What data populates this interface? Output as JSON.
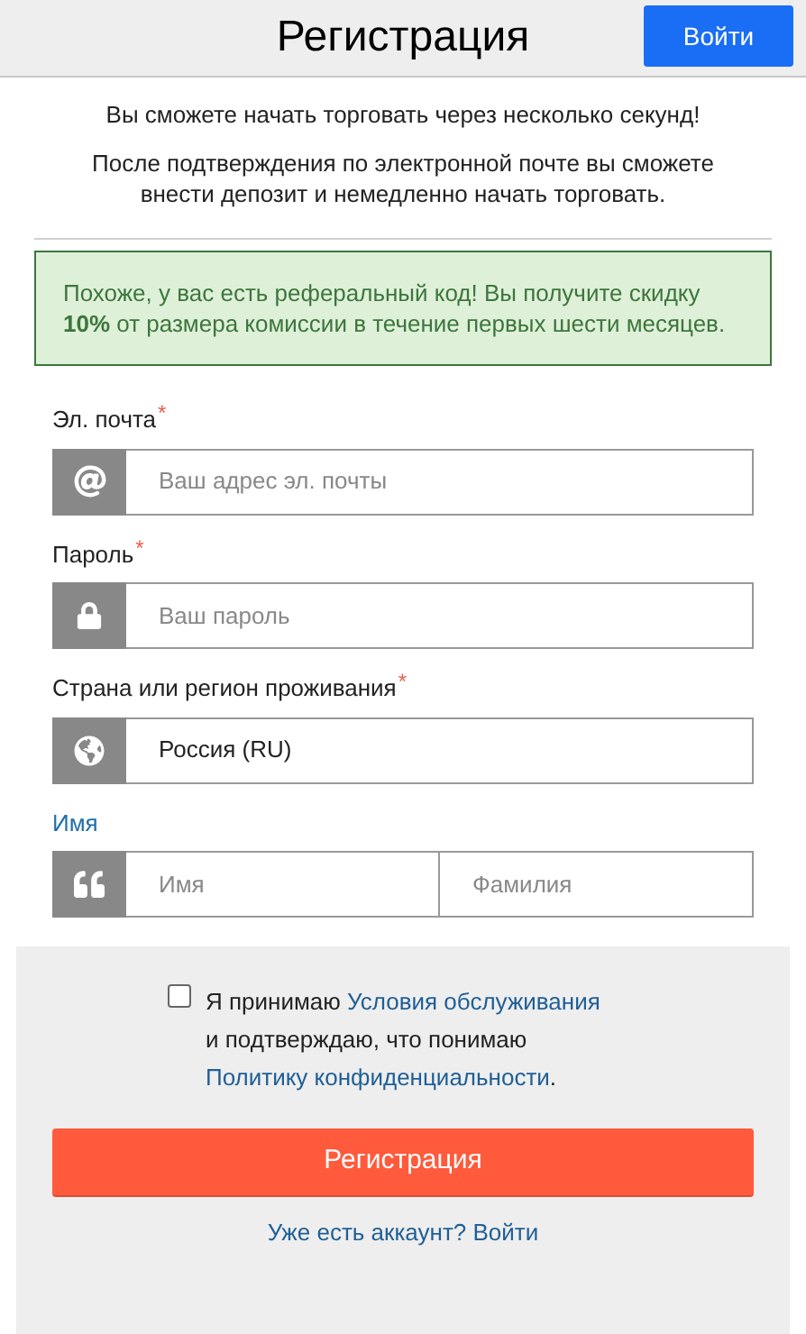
{
  "header": {
    "title": "Регистрация",
    "login_button": "Войти"
  },
  "intro": [
    "Вы сможете начать торговать через несколько секунд!",
    "После подтверждения по электронной почте вы сможете внести депозит и немедленно начать торговать."
  ],
  "referral_notice": "Похоже, у вас есть реферальный код! Вы получите скидку **10%** от размера комиссии в течение первых шести месяцев.",
  "fields": [
    {
      "label": "Эл. почта",
      "required_mark": "*",
      "kind": "email",
      "inputs": [
        {
          "placeholder": "Ваш адрес эл. почты"
        }
      ]
    },
    {
      "label": "Пароль",
      "required_mark": "*",
      "kind": "password",
      "inputs": [
        {
          "placeholder": "Ваш пароль"
        }
      ]
    },
    {
      "label": "Страна или регион проживания",
      "required_mark": "*",
      "kind": "country",
      "inputs": [
        {
          "value": "Россия (RU)"
        }
      ]
    },
    {
      "label": "Имя",
      "kind": "name",
      "inputs": [
        {
          "placeholder": "Имя"
        },
        {
          "placeholder": "Фамилия"
        }
      ]
    }
  ],
  "terms": {
    "checked": false,
    "text_before": "Я принимаю",
    "link_terms": "Условия обслуживания",
    "text_middle": "и подтверждаю, что понимаю",
    "link_privacy": "Политику конфиденциальности",
    "text_after": "."
  },
  "submit_button": "Регистрация",
  "login_link": "Уже есть аккаунт? Войти"
}
